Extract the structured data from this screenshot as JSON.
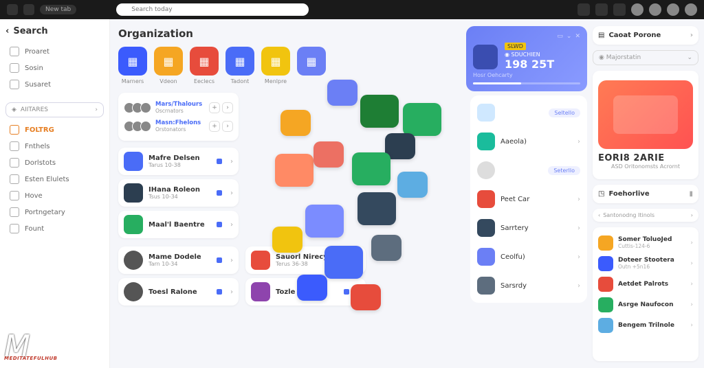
{
  "topbar": {
    "search_placeholder": "Search today",
    "chip": "New tab"
  },
  "sidebar": {
    "title": "Search",
    "top": [
      {
        "label": "Proaret"
      },
      {
        "label": "Sosin"
      },
      {
        "label": "Susaret"
      }
    ],
    "pill": "AIITARES",
    "nav": [
      {
        "label": "FOLTRG",
        "active": true
      },
      {
        "label": "Fnthels"
      },
      {
        "label": "Dorlstots"
      },
      {
        "label": "Esten Elulets"
      },
      {
        "label": "Hove"
      },
      {
        "label": "Portngetary"
      },
      {
        "label": "Fount"
      }
    ],
    "watermark": "MEDITATEFULHUB"
  },
  "main": {
    "title": "Organization",
    "cats": [
      {
        "label": "Marners",
        "color": "#3b5bfd"
      },
      {
        "label": "Vdeon",
        "color": "#f5a623"
      },
      {
        "label": "Eeclecs",
        "color": "#e74c3c"
      },
      {
        "label": "Tadont",
        "color": "#4a6cf7"
      },
      {
        "label": "Menlpre",
        "color": "#f1c40f"
      },
      {
        "label": "",
        "color": "#6b7ff5"
      }
    ],
    "team": [
      {
        "name": "Mars/Thalours",
        "sub": "Oscrnators"
      },
      {
        "name": "Masn:Fhelons",
        "sub": "Orstonators"
      }
    ],
    "people": [
      {
        "name": "Mafre Delsen",
        "sub": "Tarus 10-38",
        "color": "#4a6cf7"
      },
      {
        "name": "IHana Roleon",
        "sub": "Tsus 10-34",
        "color": "#2c3e50"
      },
      {
        "name": "Maal'l Baentre",
        "sub": "",
        "color": "#27ae60"
      }
    ],
    "projects_a": [
      {
        "name": "Mame Dodele",
        "sub": "Tarn 10-34"
      },
      {
        "name": "Toesl Ralone",
        "sub": ""
      }
    ],
    "projects_b": [
      {
        "name": "Sauorl Nirecy",
        "sub": "Terus 36-38"
      },
      {
        "name": "Tozle Rofeon",
        "sub": ""
      }
    ]
  },
  "mid": {
    "stat": {
      "badge1": "SLWD",
      "badge2": "SDUCHIEN",
      "label": "Hosr Oehcarty",
      "value": "198 25T"
    },
    "rows": [
      {
        "type": "pill",
        "label": "Seltello",
        "color": "#cfe8ff"
      },
      {
        "type": "item",
        "label": "Aaeola)",
        "color": "#1abc9c"
      },
      {
        "type": "pill2",
        "label": "Seterllo"
      },
      {
        "type": "item",
        "label": "Peet Car",
        "color": "#e74c3c"
      },
      {
        "type": "item",
        "label": "Sarrtery",
        "color": "#34495e"
      },
      {
        "type": "item",
        "label": "Ceolfu)",
        "color": "#6b7ff5"
      },
      {
        "type": "item",
        "label": "Sarsrdy",
        "color": "#5d6d7e"
      }
    ]
  },
  "right": {
    "header": "Caoat Porone",
    "select": "Majorstatin",
    "profile": {
      "name": "EORI8 2ARIE",
      "sub": "ASD Oritonomsts Acrornt"
    },
    "section": "Foehorlive",
    "crumb": "Santonodng Itinols",
    "list": [
      {
        "name": "Somer ToluoJed",
        "sub": "Cuttis-124-6",
        "color": "#f5a623"
      },
      {
        "name": "Doteer Stootera",
        "sub": "Outn +5n16",
        "color": "#3b5bfd"
      },
      {
        "name": "Aetdet Palrots",
        "sub": "",
        "color": "#e74c3c"
      },
      {
        "name": "Asrge Naufocon",
        "sub": "",
        "color": "#27ae60"
      },
      {
        "name": "Bengem Trilnole",
        "sub": "",
        "color": "#5dade2"
      }
    ]
  }
}
